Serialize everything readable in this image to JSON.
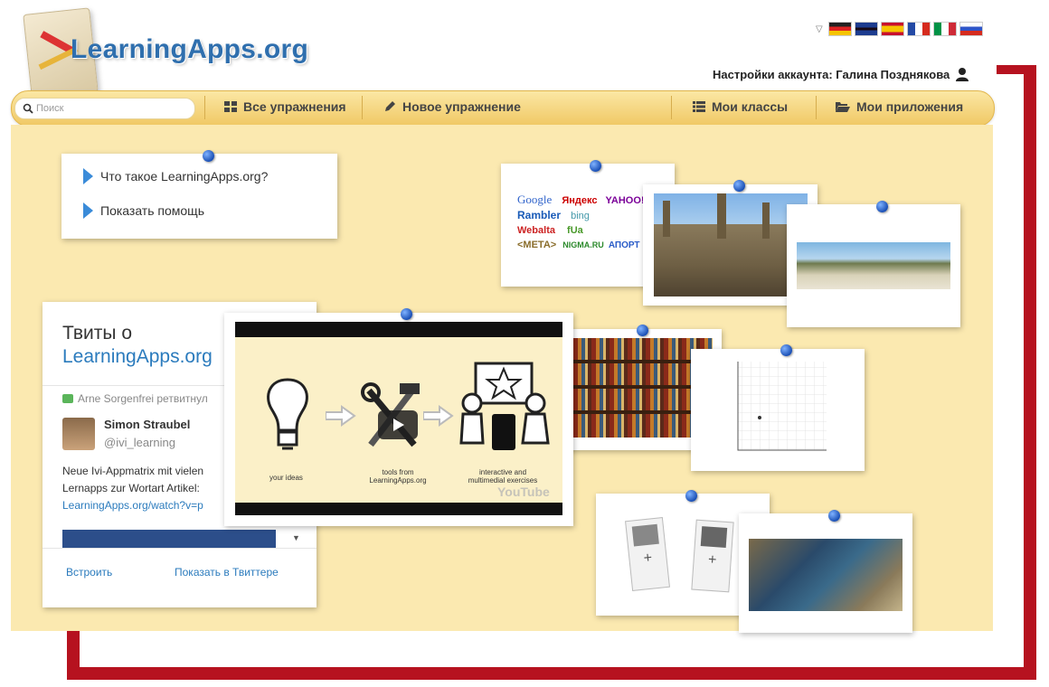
{
  "header": {
    "logo": "LearningApps.org",
    "account_label": "Настройки аккаунта: Галина Позднякова"
  },
  "languages": [
    "de-flag",
    "en-flag",
    "es-flag",
    "fr-flag",
    "it-flag",
    "ru-flag"
  ],
  "nav": {
    "search_placeholder": "Поиск",
    "all_exercises": "Все упражнения",
    "new_exercise": "Новое упражнение",
    "my_classes": "Мои классы",
    "my_apps": "Мои приложения"
  },
  "help": {
    "what_is": "Что такое LearningApps.org?",
    "show_help": "Показать помощь"
  },
  "tweets": {
    "title_line1": "Твиты о",
    "title_line2": "LearningApps.org",
    "retweet": "Arne Sorgenfrei ретвитнул",
    "author": "Simon Straubel",
    "handle": "@ivi_learning",
    "text_line1": "Neue  Ivi-Appmatrix mit vielen",
    "text_line2": "Lernapps zur Wortart Artikel:",
    "link": "LearningApps.org/watch?v=p",
    "embed": "Встроить",
    "show_on_twitter": "Показать в Твиттере"
  },
  "video": {
    "label1": "your ideas",
    "label2_line1": "tools from",
    "label2_line2": "LearningApps.org",
    "label3_line1": "interactive and",
    "label3_line2": "multimedial exercises",
    "watermark": "YouTube"
  },
  "search_logos": [
    "Google",
    "Яндекс",
    "YAHOO!",
    "Rambler",
    "bing",
    "Webalta",
    "fUa",
    "<META>",
    "NIGMA.RU",
    "АПОРТ"
  ],
  "colors": {
    "accent_blue": "#2f6fae",
    "board": "#fbe9b0",
    "nav": "#f0c864",
    "frame_red": "#b6121f"
  }
}
